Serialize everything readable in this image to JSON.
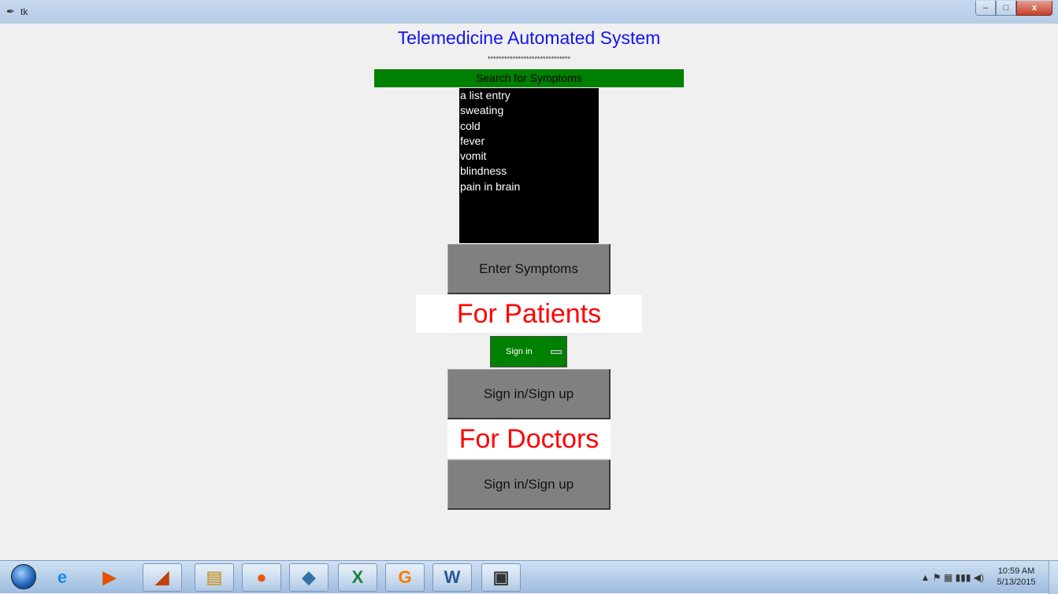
{
  "window": {
    "title": "tk",
    "controls": {
      "minimize": "–",
      "maximize": "□",
      "close": "x"
    }
  },
  "app": {
    "heading": "Telemedicine Automated System",
    "separator": "******************************",
    "search_label": "Search for Symptoms",
    "symptom_list": [
      "a list entry",
      "sweating",
      "cold",
      "fever",
      "vomit",
      "blindness",
      "pain in brain"
    ],
    "enter_symptoms_button": "Enter Symptoms",
    "patients_label": "For Patients",
    "signin_menu_label": "Sign in",
    "patients_signin_button": "Sign in/Sign up",
    "doctors_label": "For Doctors",
    "doctors_signin_button": "Sign in/Sign up"
  },
  "taskbar": {
    "apps": [
      {
        "icon": "internet-explorer-icon",
        "glyph": "e",
        "color": "#1e88e5"
      },
      {
        "icon": "media-player-icon",
        "glyph": "▶",
        "color": "#e65100"
      },
      {
        "icon": "matlab-icon",
        "glyph": "◢",
        "color": "#c2410c"
      },
      {
        "icon": "file-explorer-icon",
        "glyph": "▤",
        "color": "#c8a24a"
      },
      {
        "icon": "firefox-icon",
        "glyph": "●",
        "color": "#e8590c"
      },
      {
        "icon": "python-icon",
        "glyph": "◆",
        "color": "#3572a5"
      },
      {
        "icon": "excel-icon",
        "glyph": "X",
        "color": "#1d7f3c"
      },
      {
        "icon": "pdf-icon",
        "glyph": "G",
        "color": "#f57c00"
      },
      {
        "icon": "word-icon",
        "glyph": "W",
        "color": "#2b5797"
      },
      {
        "icon": "window-icon",
        "glyph": "▣",
        "color": "#333333"
      }
    ],
    "clock_time": "10:59 AM",
    "clock_date": "5/13/2015"
  }
}
